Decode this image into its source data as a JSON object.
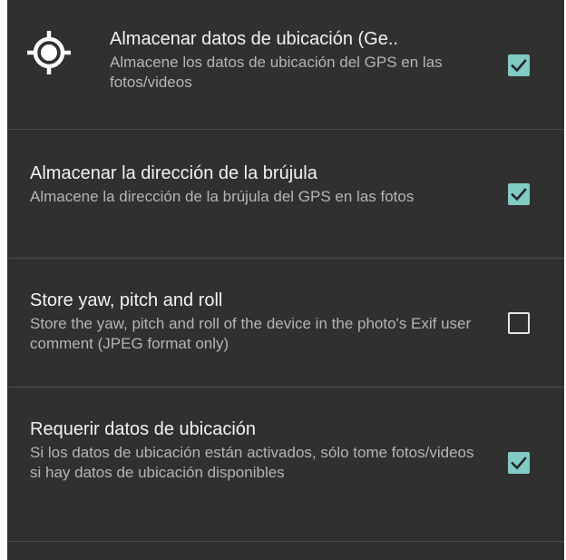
{
  "settings": [
    {
      "title": "Almacenar datos de ubicación (Ge..",
      "summary": "Almacene los datos de ubicación del GPS en las fotos/videos",
      "checked": true,
      "icon": "gps-target-icon"
    },
    {
      "title": "Almacenar la dirección de la brújula",
      "summary": "Almacene la dirección de la brújula del GPS en las fotos",
      "checked": true
    },
    {
      "title": "Store yaw, pitch and roll",
      "summary": "Store the yaw, pitch and roll of the device in the photo's Exif user comment (JPEG format only)",
      "checked": false
    },
    {
      "title": "Requerir datos de ubicación",
      "summary": "Si los datos de ubicación están activados, sólo tome fotos/videos si hay datos de ubicación disponibles",
      "checked": true
    }
  ],
  "colors": {
    "background": "#303030",
    "accent": "#80cbc4",
    "title_text": "#f2f2f2",
    "summary_text": "#b5b5b5",
    "divider": "#4a4a4a"
  }
}
